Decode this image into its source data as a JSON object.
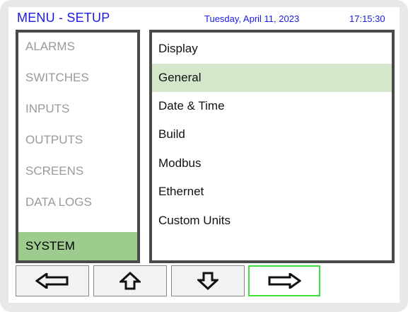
{
  "header": {
    "title": "MENU - SETUP",
    "date": "Tuesday, April 11, 2023",
    "time": "17:15:30",
    "text_color": "#1a1ae6"
  },
  "categories": [
    {
      "label": "ALARMS",
      "active": false
    },
    {
      "label": "SWITCHES",
      "active": false
    },
    {
      "label": "INPUTS",
      "active": false
    },
    {
      "label": "OUTPUTS",
      "active": false
    },
    {
      "label": "SCREENS",
      "active": false
    },
    {
      "label": "DATA LOGS",
      "active": false
    },
    {
      "label": "SYSTEM",
      "active": true
    }
  ],
  "menu_items": [
    {
      "label": "Display",
      "selected": false
    },
    {
      "label": "General",
      "selected": true
    },
    {
      "label": "Date & Time",
      "selected": false
    },
    {
      "label": "Build",
      "selected": false
    },
    {
      "label": "Modbus",
      "selected": false
    },
    {
      "label": "Ethernet",
      "selected": false
    },
    {
      "label": "Custom Units",
      "selected": false
    }
  ],
  "nav_buttons": [
    {
      "icon": "arrow-left-icon",
      "focused": false
    },
    {
      "icon": "arrow-up-icon",
      "focused": false
    },
    {
      "icon": "arrow-down-icon",
      "focused": false
    },
    {
      "icon": "arrow-right-icon",
      "focused": true
    }
  ],
  "colors": {
    "accent_green": "#9ecb8e",
    "selected_row": "#d4e7cb",
    "focus_border": "#3ee03e",
    "inactive_text": "#9a9a9a",
    "panel_border": "#4a4a4a"
  }
}
